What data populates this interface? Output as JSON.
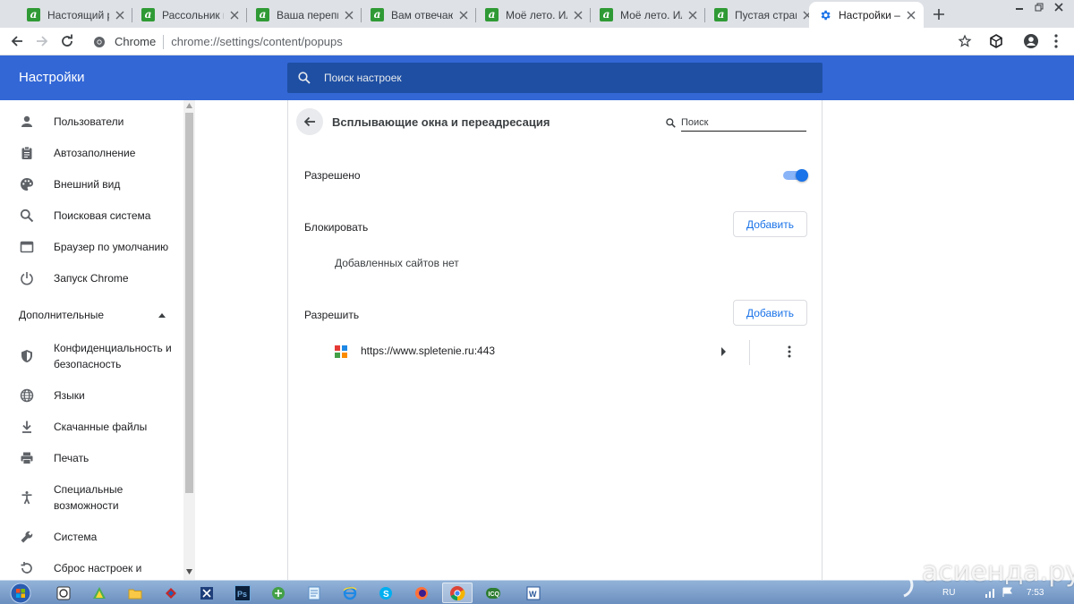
{
  "browser": {
    "tabs": [
      {
        "title": "Настоящий ра",
        "favicon": "green-a-icon",
        "active": false
      },
      {
        "title": "Рассольник на",
        "favicon": "green-a-icon",
        "active": false
      },
      {
        "title": "Ваша переписк",
        "favicon": "green-a-icon",
        "active": false
      },
      {
        "title": "Вам отвечают",
        "favicon": "green-a-icon",
        "active": false
      },
      {
        "title": "Моё лето. Или",
        "favicon": "green-a-icon",
        "active": false
      },
      {
        "title": "Моё лето. Или",
        "favicon": "green-a-icon",
        "active": false
      },
      {
        "title": "Пустая страни",
        "favicon": "green-a-icon",
        "active": false
      },
      {
        "title": "Настройки – В",
        "favicon": "gear-icon",
        "active": true
      }
    ],
    "omnibox": {
      "site_label": "Chrome",
      "url": "chrome://settings/content/popups"
    }
  },
  "settings": {
    "title": "Настройки",
    "search_placeholder": "Поиск настроек",
    "sidebar": {
      "items": [
        {
          "label": "Пользователи",
          "icon": "person-icon"
        },
        {
          "label": "Автозаполнение",
          "icon": "clipboard-icon"
        },
        {
          "label": "Внешний вид",
          "icon": "palette-icon"
        },
        {
          "label": "Поисковая система",
          "icon": "search-icon"
        },
        {
          "label": "Браузер по умолчанию",
          "icon": "browser-icon"
        },
        {
          "label": "Запуск Chrome",
          "icon": "power-icon"
        }
      ],
      "advanced_label": "Дополнительные",
      "advanced_items": [
        {
          "label": "Конфиденциальность и безопасность",
          "icon": "shield-icon"
        },
        {
          "label": "Языки",
          "icon": "globe-icon"
        },
        {
          "label": "Скачанные файлы",
          "icon": "download-icon"
        },
        {
          "label": "Печать",
          "icon": "printer-icon"
        },
        {
          "label": "Специальные возможности",
          "icon": "accessibility-icon"
        },
        {
          "label": "Система",
          "icon": "wrench-icon"
        },
        {
          "label": "Сброс настроек и",
          "icon": "reset-icon"
        }
      ]
    },
    "page": {
      "heading": "Всплывающие окна и переадресация",
      "search_placeholder": "Поиск",
      "allowed_label": "Разрешено",
      "allowed_toggle_on": true,
      "block_section": {
        "title": "Блокировать",
        "add_label": "Добавить",
        "empty_text": "Добавленных сайтов нет"
      },
      "allow_section": {
        "title": "Разрешить",
        "add_label": "Добавить",
        "sites": [
          {
            "url": "https://www.spletenie.ru:443"
          }
        ]
      }
    }
  },
  "taskbar": {
    "lang": "RU",
    "time": "7:53"
  },
  "watermark": {
    "text": "асиенда.ру"
  },
  "colors": {
    "header_blue": "#3367d6",
    "search_blue": "#1e4fa3",
    "accent": "#1a73e8"
  }
}
